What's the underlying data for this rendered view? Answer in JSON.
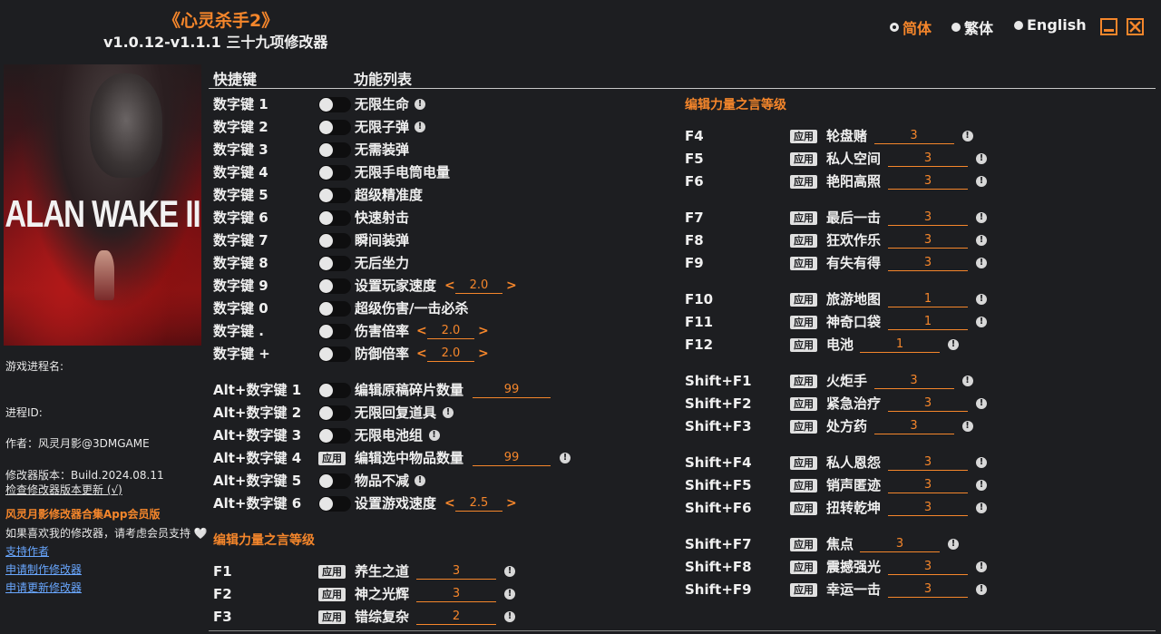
{
  "header": {
    "title": "《心灵杀手2》",
    "subtitle": "v1.0.12-v1.1.1 三十九项修改器"
  },
  "languages": [
    {
      "label": "简体",
      "selected": true
    },
    {
      "label": "繁体",
      "selected": false
    },
    {
      "label": "English",
      "selected": false
    }
  ],
  "cover": {
    "title": "ALAN WAKE II"
  },
  "sidebar": {
    "process_name_label": "游戏进程名:",
    "process_id_label": "进程ID:",
    "author": "作者：风灵月影@3DMGAME",
    "version": "修改器版本：Build.2024.08.11",
    "check_update": "检查修改器版本更新 (√)",
    "promo_title": "风灵月影修改器合集App会员版",
    "promo_text": "如果喜欢我的修改器，请考虑会员支持 🤍",
    "links": [
      "支持作者",
      "申请制作修改器",
      "申请更新修改器"
    ]
  },
  "columns": {
    "hotkey": "快捷键",
    "features": "功能列表"
  },
  "apply_label": "应用",
  "left_rows": [
    {
      "key": "数字键 1",
      "type": "toggle",
      "name": "无限生命",
      "info": true
    },
    {
      "key": "数字键 2",
      "type": "toggle",
      "name": "无限子弹",
      "info": true
    },
    {
      "key": "数字键 3",
      "type": "toggle",
      "name": "无需装弹",
      "info": false
    },
    {
      "key": "数字键 4",
      "type": "toggle",
      "name": "无限手电筒电量",
      "info": false
    },
    {
      "key": "数字键 5",
      "type": "toggle",
      "name": "超级精准度",
      "info": false
    },
    {
      "key": "数字键 6",
      "type": "toggle",
      "name": "快速射击",
      "info": false
    },
    {
      "key": "数字键 7",
      "type": "toggle",
      "name": "瞬间装弹",
      "info": false
    },
    {
      "key": "数字键 8",
      "type": "toggle",
      "name": "无后坐力",
      "info": false
    },
    {
      "key": "数字键 9",
      "type": "toggle",
      "name": "设置玩家速度",
      "info": false,
      "stepper": "2.0"
    },
    {
      "key": "数字键 0",
      "type": "toggle",
      "name": "超级伤害/一击必杀",
      "info": false
    },
    {
      "key": "数字键 .",
      "type": "toggle",
      "name": "伤害倍率",
      "info": false,
      "stepper": "2.0"
    },
    {
      "key": "数字键 +",
      "type": "toggle",
      "name": "防御倍率",
      "info": false,
      "stepper": "2.0"
    },
    {
      "key": "Alt+数字键 1",
      "type": "toggle",
      "name": "编辑原稿碎片数量",
      "info": false,
      "value": "99"
    },
    {
      "key": "Alt+数字键 2",
      "type": "toggle",
      "name": "无限回复道具",
      "info": true
    },
    {
      "key": "Alt+数字键 3",
      "type": "toggle",
      "name": "无限电池组",
      "info": true
    },
    {
      "key": "Alt+数字键 4",
      "type": "apply",
      "name": "编辑选中物品数量",
      "info": true,
      "value": "99"
    },
    {
      "key": "Alt+数字键 5",
      "type": "toggle",
      "name": "物品不减",
      "info": true
    },
    {
      "key": "Alt+数字键 6",
      "type": "toggle",
      "name": "设置游戏速度",
      "info": false,
      "stepper": "2.5"
    }
  ],
  "left_section": {
    "title": "编辑力量之言等级",
    "rows": [
      {
        "key": "F1",
        "name": "养生之道",
        "value": "3"
      },
      {
        "key": "F2",
        "name": "神之光辉",
        "value": "3"
      },
      {
        "key": "F3",
        "name": "错综复杂",
        "value": "2"
      }
    ]
  },
  "right_section": {
    "title": "编辑力量之言等级",
    "rows": [
      {
        "key": "F4",
        "name": "轮盘赌",
        "value": "3"
      },
      {
        "key": "F5",
        "name": "私人空间",
        "value": "3"
      },
      {
        "key": "F6",
        "name": "艳阳高照",
        "value": "3"
      },
      {
        "key": "F7",
        "name": "最后一击",
        "value": "3"
      },
      {
        "key": "F8",
        "name": "狂欢作乐",
        "value": "3"
      },
      {
        "key": "F9",
        "name": "有失有得",
        "value": "3"
      },
      {
        "key": "F10",
        "name": "旅游地图",
        "value": "1"
      },
      {
        "key": "F11",
        "name": "神奇口袋",
        "value": "1"
      },
      {
        "key": "F12",
        "name": "电池",
        "value": "1"
      },
      {
        "key": "Shift+F1",
        "name": "火炬手",
        "value": "3"
      },
      {
        "key": "Shift+F2",
        "name": "紧急治疗",
        "value": "3"
      },
      {
        "key": "Shift+F3",
        "name": "处方药",
        "value": "3"
      },
      {
        "key": "Shift+F4",
        "name": "私人恩怨",
        "value": "3"
      },
      {
        "key": "Shift+F5",
        "name": "销声匿迹",
        "value": "3"
      },
      {
        "key": "Shift+F6",
        "name": "扭转乾坤",
        "value": "3"
      },
      {
        "key": "Shift+F7",
        "name": "焦点",
        "value": "3"
      },
      {
        "key": "Shift+F8",
        "name": "震撼强光",
        "value": "3"
      },
      {
        "key": "Shift+F9",
        "name": "幸运一击",
        "value": "3"
      }
    ]
  }
}
